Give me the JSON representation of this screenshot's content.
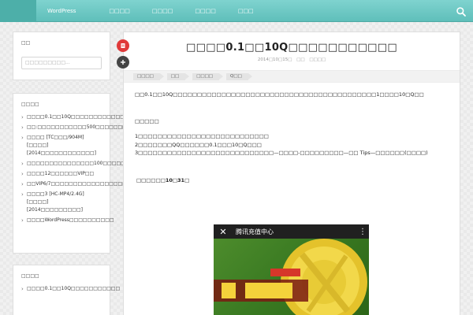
{
  "nav": {
    "brand": "    ",
    "items": [
      "WordPress",
      "□□□□",
      "□□□□",
      "□□□□",
      "□□□"
    ]
  },
  "sidebar": {
    "search_title": "□□",
    "search_placeholder": "□□□□□□□□□...",
    "recent_title": "□□□□",
    "recent_items": [
      "□□□□0.1□□10Q□□□□□□□□□□□□",
      "□□:□□□□□□□□□□□500□□□□□□□□□□□3□□□□□□",
      "□□□□ [TC□□□/904M][□□□□][2014□□□□□□□□□□□□]",
      "□□□□□□□□□□□□□□□100□□□□□",
      "□□□□12□□□□□□VIP□□",
      "□□VIP6/7□□□□□□□□□□□□□□□□□□□",
      "□□□□3 [HC-MP4/2.4G][□□□□][2014□□□□□□□□□]",
      "□□□□WordPress□□□□□□□□□□"
    ],
    "bottom_title": "□□□□",
    "bottom_items": [
      "□□□□0.1□□10Q□□□□□□□□□□□"
    ]
  },
  "post": {
    "title": "□□□□0.1□□10Q□□□□□□□□□□□",
    "date": "2014□10□15□",
    "meta_author": "□□",
    "meta_category": "□□□□",
    "tags": [
      "□□□□",
      "□□",
      "□□□□",
      "Q□□"
    ],
    "intro": "□□0.1□□10Q□□□□□□□□□□□□□□□□□□□□□□□□□□□□□□□□□□□□□□□□□□1□□□□10□Q□□",
    "section_title": "□□□□□",
    "steps": [
      "1□□□□□□□□□□□□□□□□□□□□□□□□□□□",
      "2□□□□□□□QQ□□□□□□0.1□□□10□Q□□□",
      "3□□□□□□□□□□□□□□□□□□□□□□□□□□□□—□□□□-□□□□□□□□□—□□ Tips—□□□□□□(□□□□)"
    ],
    "deadline": "□□□□□□10□31□",
    "image_header_title": "腾讯充值中心",
    "image_close": "✕",
    "image_more": "⋮"
  },
  "colors": {
    "topbar": "#66c4bf",
    "brand_bg": "#4dafa9",
    "red_button": "#e03a3a",
    "dark_button": "#444444"
  },
  "icons": {
    "search": "search-icon",
    "bookmark": "bookmark-icon",
    "plus": "plus-icon"
  }
}
